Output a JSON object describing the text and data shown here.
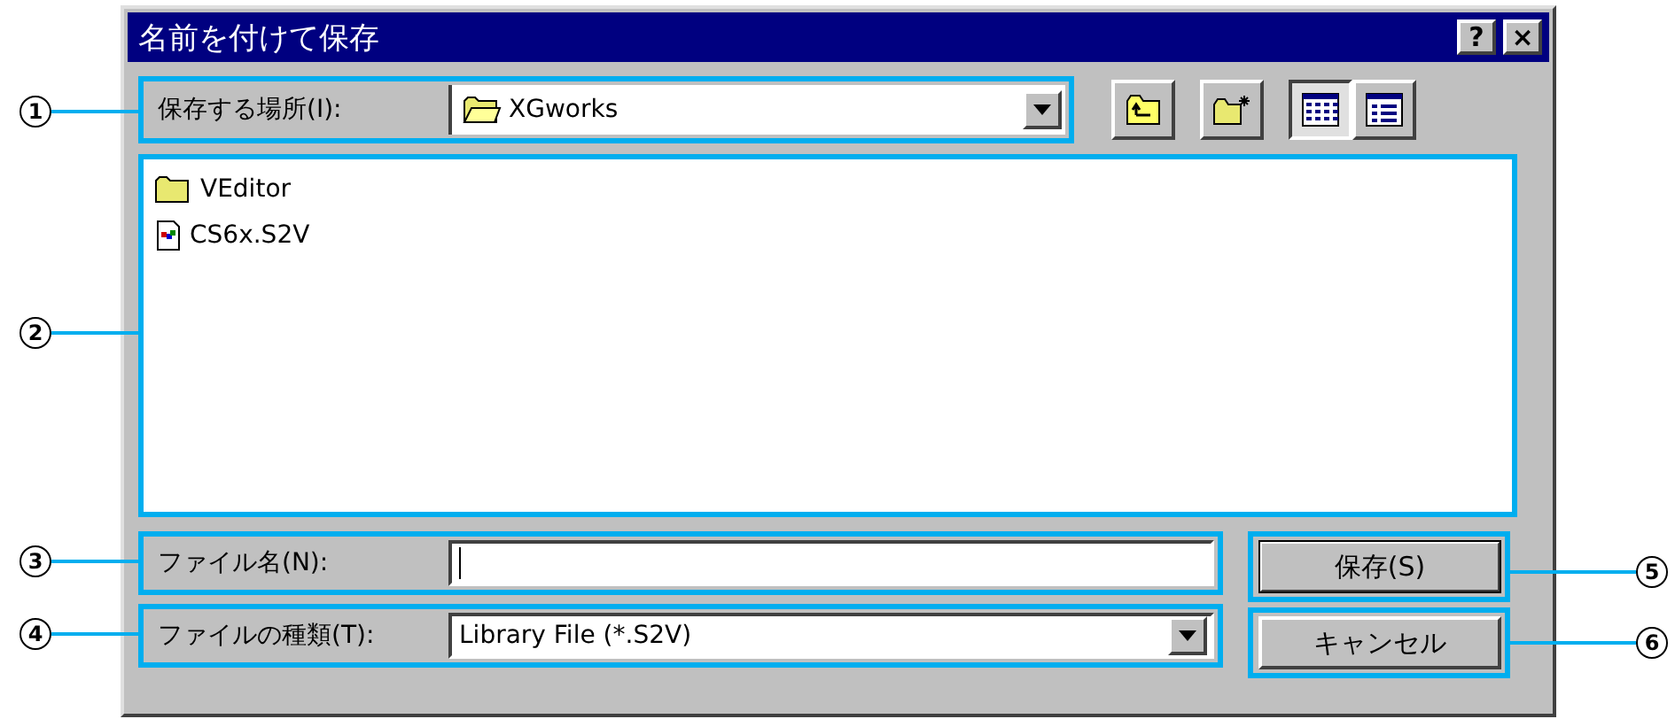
{
  "window": {
    "title": "名前を付けて保存",
    "title_buttons": [
      {
        "kind": "help",
        "label": "?"
      },
      {
        "kind": "close",
        "label": "×"
      }
    ]
  },
  "save_in": {
    "label": "保存する場所(I):",
    "value": "XGworks",
    "callout": "1"
  },
  "toolbar": [
    {
      "kind": "up-folder",
      "selected": false
    },
    {
      "kind": "new-folder",
      "selected": false
    },
    {
      "kind": "list-view",
      "selected": true
    },
    {
      "kind": "details-view",
      "selected": false
    }
  ],
  "file_list": {
    "callout": "2",
    "items": [
      {
        "kind": "folder",
        "name": "VEditor"
      },
      {
        "kind": "file",
        "name": "CS6x.S2V"
      }
    ]
  },
  "file_name": {
    "label": "ファイル名(N):",
    "callout": "3"
  },
  "file_type": {
    "label": "ファイルの種類(T):",
    "value": "Library File (*.S2V)",
    "callout": "4"
  },
  "buttons": [
    {
      "label": "保存(S)",
      "callout": "5"
    },
    {
      "label": "キャンセル",
      "callout": "6"
    }
  ]
}
